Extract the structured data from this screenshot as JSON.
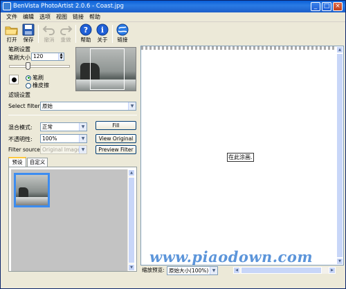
{
  "window": {
    "title": "BenVista PhotoArtist 2.0.6 - Coast.jpg"
  },
  "titlebar_buttons": {
    "minimize": "_",
    "maximize": "□",
    "close": "×"
  },
  "menu": [
    "文件",
    "编辑",
    "选项",
    "视图",
    "链接",
    "帮助"
  ],
  "toolbar": {
    "open": "打开",
    "save": "保存",
    "undo": "撤消",
    "redo": "重做",
    "help": "帮助",
    "about": "关于",
    "link": "链接"
  },
  "brush": {
    "section_title": "笔刷设置",
    "size_label": "笔刷大小:",
    "size_value": "120",
    "mode_brush": "笔刷",
    "mode_eraser": "橡皮擦"
  },
  "filter": {
    "section_title": "滤镜设置",
    "select_label": "Select filter:",
    "select_value": "原始",
    "blend_label": "混合模式:",
    "blend_value": "正常",
    "opacity_label": "不透明性:",
    "opacity_value": "100%",
    "source_label": "Filter source:",
    "source_value": "Original Image",
    "fill_button": "Fill",
    "view_original_button": "View Original",
    "preview_button": "Preview Filter"
  },
  "tabs": [
    "预设",
    "自定义"
  ],
  "canvas": {
    "hint": "在此涂画."
  },
  "status": {
    "zoom_label": "缩放预览:",
    "zoom_value": "原始大小(100%)"
  },
  "watermark": "www.piaodown.com",
  "colors": {
    "title_blue": "#0a5fd8",
    "selection_blue": "#3c8cf0",
    "watermark": "#4b8ad6"
  }
}
